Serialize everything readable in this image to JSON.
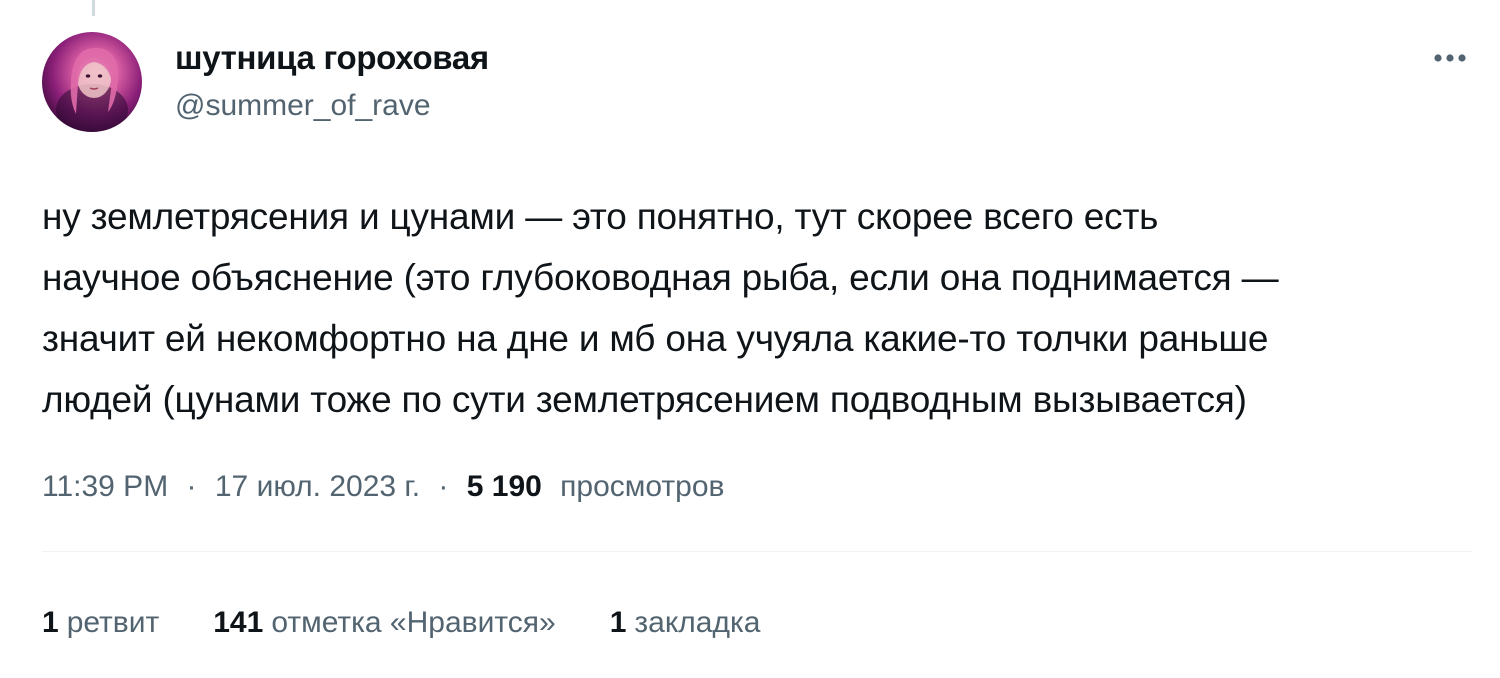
{
  "tweet": {
    "author": {
      "display_name": "шутница гороховая",
      "handle": "@summer_of_rave"
    },
    "more_icon": "more-horizontal-icon",
    "text_lines": [
      "ну землетрясения и цунами — это понятно, тут скорее всего есть",
      "научное объяснение (это глубоководная рыба, если она поднимается —",
      "значит ей некомфортно на дне и мб она учуяла какие-то толчки раньше",
      "людей (цунами тоже по сути землетрясением подводным вызывается)"
    ],
    "meta": {
      "time": "11:39 PM",
      "separator": "·",
      "date": "17 июл. 2023 г.",
      "views_count": "5 190",
      "views_label": "просмотров"
    },
    "stats": {
      "retweets_count": "1",
      "retweets_label": "ретвит",
      "likes_count": "141",
      "likes_label": "отметка «Нравится»",
      "bookmarks_count": "1",
      "bookmarks_label": "закладка"
    }
  },
  "colors": {
    "text_primary": "#0f1419",
    "text_secondary": "#536471",
    "divider": "#eff3f4",
    "thread_line": "#cfd9de"
  }
}
